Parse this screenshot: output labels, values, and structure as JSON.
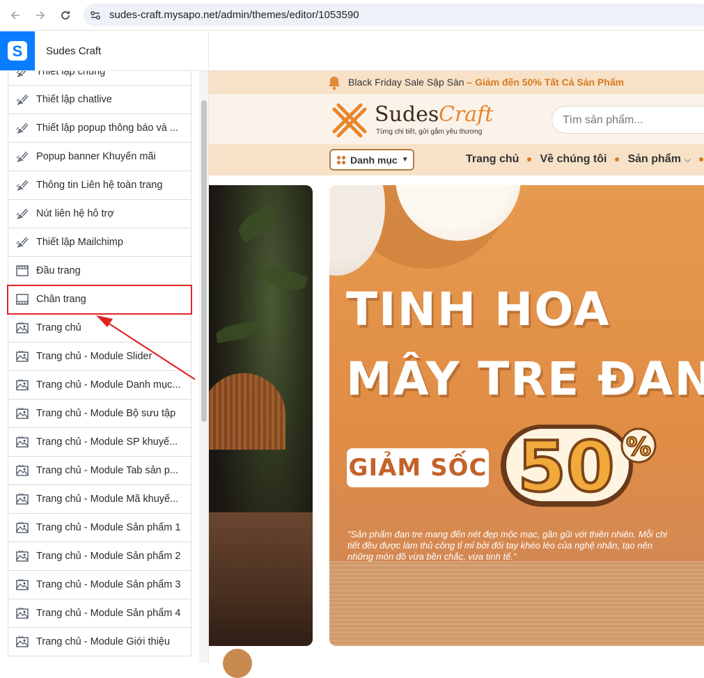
{
  "browser": {
    "url": "sudes-craft.mysapo.net/admin/themes/editor/1053590",
    "back_icon": "arrow-left-icon",
    "forward_icon": "arrow-right-icon",
    "reload_icon": "reload-icon",
    "site_info_icon": "tune-icon"
  },
  "admin": {
    "logo_letter": "S",
    "store_name": "Sudes Craft"
  },
  "sidebar": {
    "items": [
      {
        "label": "Thiết lập chung",
        "icon": "brush-icon"
      },
      {
        "label": "Thiết lập chatlive",
        "icon": "brush-icon"
      },
      {
        "label": "Thiết lập popup thông báo và ...",
        "icon": "brush-icon"
      },
      {
        "label": "Popup banner Khuyến mãi",
        "icon": "brush-icon"
      },
      {
        "label": "Thông tin Liên hệ toàn trang",
        "icon": "brush-icon"
      },
      {
        "label": "Nút liên hệ hỗ trợ",
        "icon": "brush-icon"
      },
      {
        "label": "Thiết lập Mailchimp",
        "icon": "brush-icon"
      },
      {
        "label": "Đầu trang",
        "icon": "header-layout-icon"
      },
      {
        "label": "Chân trang",
        "icon": "footer-layout-icon",
        "highlighted": true
      },
      {
        "label": "Trang chủ",
        "icon": "image-layout-icon"
      },
      {
        "label": "Trang chủ - Module Slider",
        "icon": "image-layout-icon"
      },
      {
        "label": "Trang chủ - Module Danh mục...",
        "icon": "image-layout-icon"
      },
      {
        "label": "Trang chủ - Module Bộ sưu tập",
        "icon": "image-layout-icon"
      },
      {
        "label": "Trang chủ - Module SP khuyế...",
        "icon": "image-layout-icon"
      },
      {
        "label": "Trang chủ - Module Tab sản p...",
        "icon": "image-layout-icon"
      },
      {
        "label": "Trang chủ - Module Mã khuyế...",
        "icon": "image-layout-icon"
      },
      {
        "label": "Trang chủ - Module Sản phẩm 1",
        "icon": "image-layout-icon"
      },
      {
        "label": "Trang chủ - Module Sản phẩm 2",
        "icon": "image-layout-icon"
      },
      {
        "label": "Trang chủ - Module Sản phẩm 3",
        "icon": "image-layout-icon"
      },
      {
        "label": "Trang chủ - Module Sản phẩm 4",
        "icon": "image-layout-icon"
      },
      {
        "label": "Trang chủ - Module Giới thiệu",
        "icon": "image-layout-icon"
      }
    ]
  },
  "preview": {
    "promo": {
      "text": "Black Friday Sale Sập Sàn",
      "highlight": " – Giảm đến 50% Tất Cả Sản Phẩm"
    },
    "logo": {
      "word1": "Sudes",
      "word2": "Craft",
      "slogan": "Từng chi tiết, gửi gắm yêu thương"
    },
    "search_placeholder": "Tìm sản phẩm...",
    "category_button": "Danh mục",
    "menu": [
      "Trang chủ",
      "Về chúng tôi",
      "Sản phẩm"
    ],
    "banner": {
      "line1": "TINH HOA",
      "line2": "MÂY TRE ĐAN",
      "discount_label": "GIẢM SỐC",
      "discount_value": "50",
      "discount_unit": "%",
      "quote": "\"Sản phẩm đan tre mang đến nét đẹp mộc mạc, gần gũi với thiên nhiên. Mỗi chi tiết đều được làm thủ công tỉ mỉ bởi đôi tay khéo léo của nghệ nhân, tạo nên những món đồ vừa bền chắc, vừa tinh tế.\""
    }
  },
  "colors": {
    "accent_blue": "#0a7cff",
    "highlight_red": "#e02424",
    "brand_orange": "#e9852c",
    "promo_bg": "#f7e2c8"
  }
}
